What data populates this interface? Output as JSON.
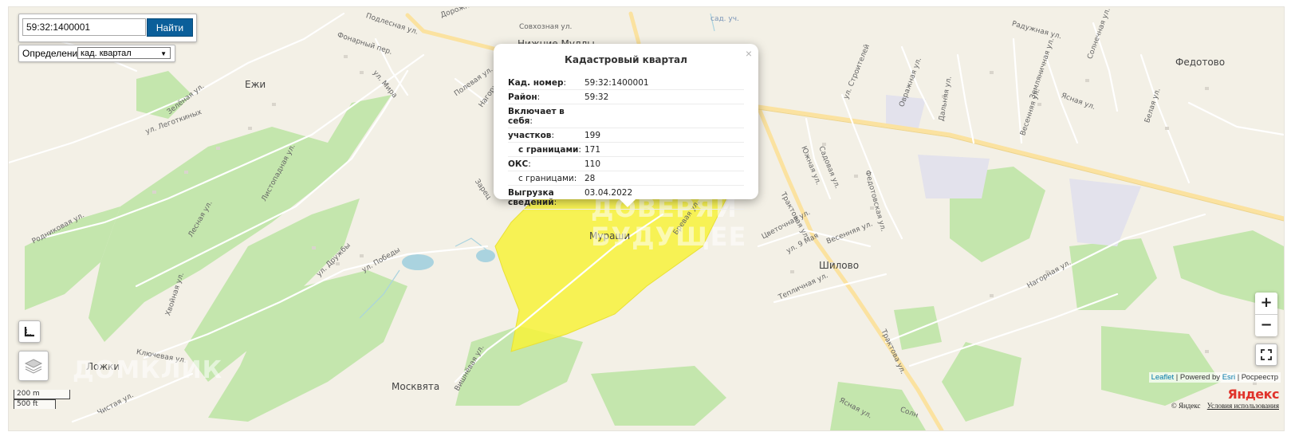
{
  "search": {
    "value": "59:32:1400001",
    "button": "Найти"
  },
  "definition": {
    "label": "Определение:",
    "selected": "кад. квартал"
  },
  "popup": {
    "title": "Кадастровый квартал",
    "close": "×",
    "rows": [
      {
        "key": "Кад. номер",
        "sep": ":",
        "value": "59:32:1400001",
        "bold": true,
        "indent": false
      },
      {
        "key": "Район",
        "sep": ":",
        "value": "59:32",
        "bold": true,
        "indent": false
      },
      {
        "key": "Включает в себя",
        "sep": ":",
        "value": "",
        "bold": true,
        "indent": false
      },
      {
        "key": "участков",
        "sep": ":",
        "value": "199",
        "bold": true,
        "indent": false
      },
      {
        "key": "с границами",
        "sep": ":",
        "value": "171",
        "bold": true,
        "indent": true
      },
      {
        "key": "ОКС",
        "sep": ":",
        "value": "110",
        "bold": true,
        "indent": false
      },
      {
        "key": "с границами",
        "sep": ":",
        "value": "28",
        "bold": false,
        "indent": true
      },
      {
        "key": "Выгрузка сведений",
        "sep": ":",
        "value": "03.04.2022",
        "bold": true,
        "indent": false
      }
    ]
  },
  "places": [
    "Ежи",
    "Мураши",
    "Шилово",
    "Федотово",
    "Ложки",
    "Москвята",
    "Нижние Муллы"
  ],
  "streets": [
    "Подлесная ул.",
    "Совхозная ул.",
    "Дорожн",
    "Фонарный пер.",
    "ул. Мира",
    "Полевая ул.",
    "Зелёная ул.",
    "ул. Леготкиных",
    "Листопадная ул.",
    "Родниковая ул.",
    "Лесная ул.",
    "ул. Дружбы",
    "ул. Победы",
    "Хвойная ул.",
    "Ключевая ул.",
    "Вишнёвая ул.",
    "Трактовая ул.",
    "Южная ул.",
    "Садовая ул.",
    "ул. Строителей",
    "Овражная ул.",
    "Дальняя ул.",
    "Радужная ул.",
    "Солнечная ул.",
    "Земляничная ул.",
    "Ясная ул.",
    "Весенняя ул.",
    "Белая ул.",
    "Федотовская ул.",
    "Цветочная ул.",
    "ул. 9 Мая",
    "Весенняя ул.",
    "Тепличная ул.",
    "Нагорная ул.",
    "Бревая ул.",
    "сад. уч.",
    "Зарец",
    "Нагорн",
    "Ясная ул.",
    "Солн",
    "Трактова ул.",
    "Чистая ул."
  ],
  "watermarks": [
    "ДОМКЛИК",
    "ДОВЕРЯЙ БУДУЩЕЕ"
  ],
  "attribution": {
    "leaflet": "Leaflet",
    "powered": "| Powered by",
    "esri": "Esri",
    "rosreestr": "| Росреестр"
  },
  "yandex": {
    "logo_y": "Я",
    "logo_rest": "ндекс",
    "copyright": "© Яндекс",
    "terms": "Условия использования"
  },
  "scale": {
    "metric": "200 m",
    "imperial": "500 ft"
  },
  "zoom": {
    "in": "+",
    "out": "−"
  },
  "colors": {
    "parcel": "#f7f23a",
    "forest": "#bfe3a6",
    "road": "#fbe6a2",
    "water": "#aad3df",
    "land": "#f3f0e6",
    "button": "#0b5f9a"
  }
}
